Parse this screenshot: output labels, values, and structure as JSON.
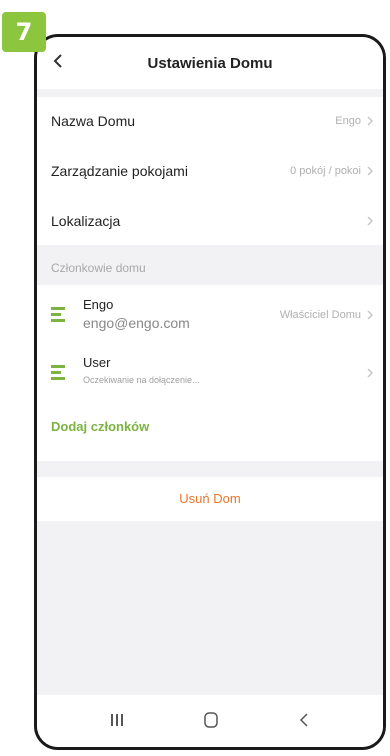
{
  "step": {
    "number": "7"
  },
  "header": {
    "title": "Ustawienia Domu"
  },
  "settings": {
    "rows": [
      {
        "label": "Nazwa Domu",
        "value": "Engo"
      },
      {
        "label": "Zarządzanie pokojami",
        "value": "0 pokój / pokoi"
      },
      {
        "label": "Lokalizacja",
        "value": ""
      }
    ]
  },
  "members": {
    "section_label": "Członkowie domu",
    "items": [
      {
        "name": "Engo",
        "email": "engo@engo.com",
        "role": "Właściciel Domu"
      },
      {
        "name": "User",
        "status": "Oczekiwanie na dołączenie..."
      }
    ],
    "add_label": "Dodaj członków"
  },
  "actions": {
    "delete_label": "Usuń Dom"
  },
  "colors": {
    "accent_green": "#7cb342",
    "badge_green": "#8cc63f",
    "delete_orange": "#e8762b"
  }
}
